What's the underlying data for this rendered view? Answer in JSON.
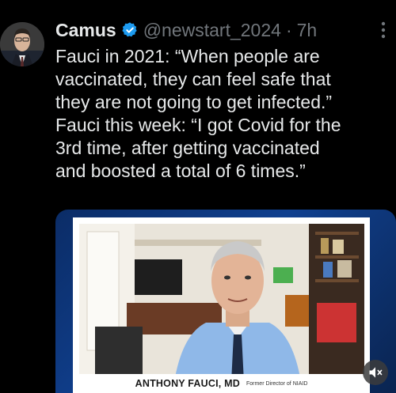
{
  "tweet": {
    "author": {
      "display_name": "Camus",
      "handle": "@newstart_2024",
      "separator": "·",
      "time": "7h",
      "verified_icon": "verified-badge-icon"
    },
    "text": "Fauci in 2021: “When people are\nvaccinated, they can feel safe that\nthey are not going to get infected.”\nFauci this week: “I got Covid for the\n3rd time, after getting vaccinated\nand boosted a total of 6 times.”",
    "media": {
      "caption_name": "ANTHONY FAUCI, MD",
      "caption_title": "Former Director of NIAID",
      "mute_icon": "speaker-muted-icon"
    }
  },
  "colors": {
    "background": "#000000",
    "text": "#e7e9ea",
    "secondary": "#71767b",
    "verified": "#1d9bf0"
  }
}
